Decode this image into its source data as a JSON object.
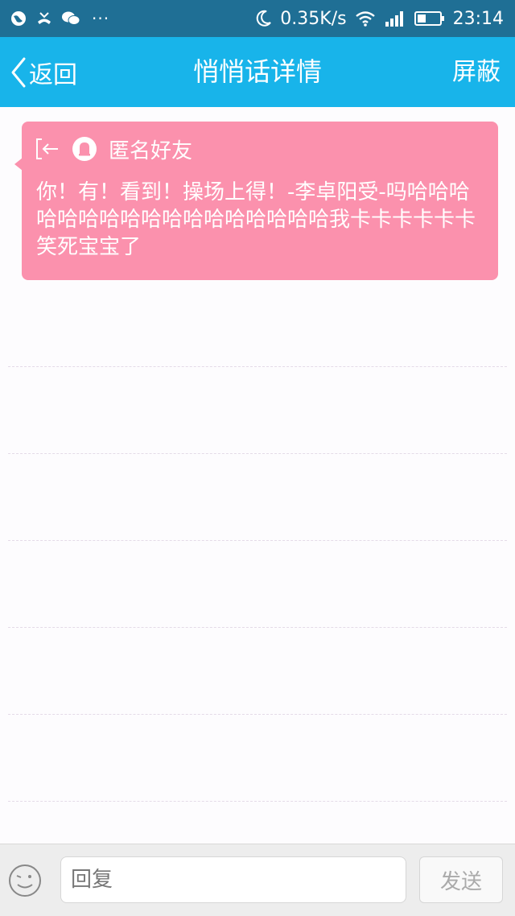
{
  "status_bar": {
    "icons_left": [
      "globe-icon",
      "missed-call-icon",
      "wechat-icon"
    ],
    "more": "···",
    "icons_right": [
      "moon-icon",
      "wifi-icon",
      "signal-icon",
      "battery-icon"
    ],
    "speed": "0.35K/s",
    "time": "23:14"
  },
  "header": {
    "back_label": "返回",
    "title": "悄悄话详情",
    "block_label": "屏蔽"
  },
  "message": {
    "sender": "匿名好友",
    "text": "你！有！看到！操场上得！-李卓阳受-吗哈哈哈哈哈哈哈哈哈哈哈哈哈哈哈哈哈我卡卡卡卡卡卡笑死宝宝了"
  },
  "reply_bar": {
    "placeholder": "回复",
    "send_label": "发送"
  },
  "colors": {
    "status_bar": "#1f6f95",
    "title_bar": "#18b4ea",
    "bubble": "#fb91ad",
    "background": "#fdfcfe"
  }
}
